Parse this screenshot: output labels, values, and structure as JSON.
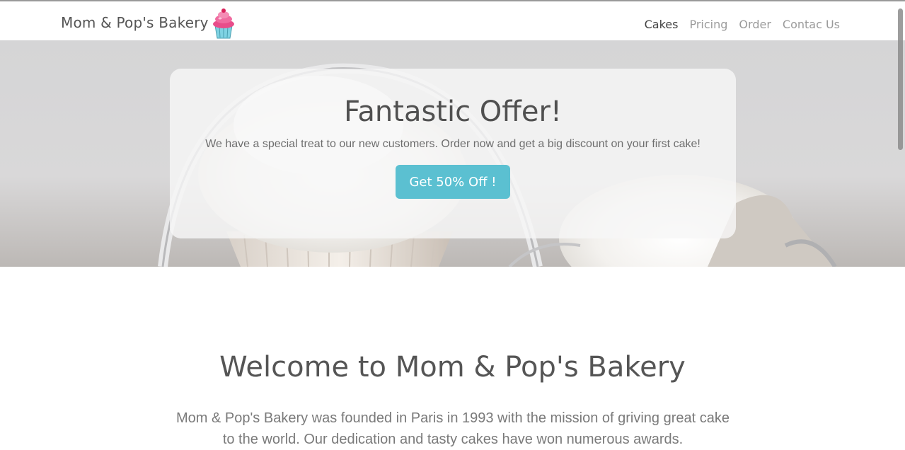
{
  "navbar": {
    "brand": "Mom & Pop's Bakery",
    "logo_icon": "cupcake-icon",
    "links": [
      {
        "label": "Cakes",
        "active": true
      },
      {
        "label": "Pricing",
        "active": false
      },
      {
        "label": "Order",
        "active": false
      },
      {
        "label": "Contac Us",
        "active": false
      }
    ]
  },
  "hero": {
    "title": "Fantastic Offer!",
    "text": "We have a special treat to our new customers. Order now and get a big discount on your first cake!",
    "button_label": "Get 50% Off !",
    "button_color": "#5bc0d1"
  },
  "welcome": {
    "title": "Welcome to Mom & Pop's Bakery",
    "text": "Mom & Pop's Bakery was founded in Paris in 1993 with the mission of griving great cake to the world. Our dedication and tasty cakes have won numerous awards."
  }
}
